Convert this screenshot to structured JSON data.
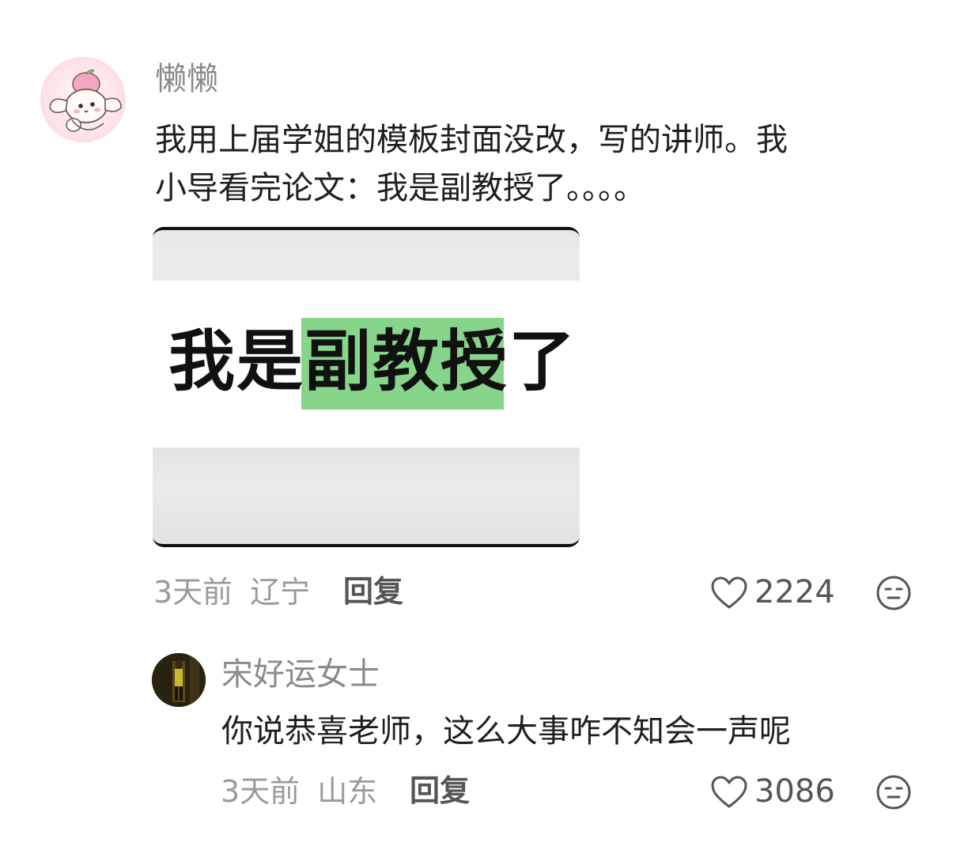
{
  "comments": [
    {
      "username": "懒懒",
      "text_line1": "我用上届学姐的模板封面没改，写的讲师。我",
      "text_line2": "小导看完论文：我是副教授了。。。。",
      "image": {
        "text_plain_1": "我是",
        "text_highlight": "副教授",
        "text_plain_2": "了",
        "highlight_color": "#86d58a"
      },
      "time": "3天前",
      "location": "辽宁",
      "reply_label": "回复",
      "likes": "2224"
    },
    {
      "username": "宋好运女士",
      "text": "你说恭喜老师，这么大事咋不知会一声呢",
      "time": "3天前",
      "location": "山东",
      "reply_label": "回复",
      "likes": "3086"
    }
  ],
  "icons": {
    "like": "heart-outline-icon",
    "dislike": "neutral-face-icon"
  }
}
